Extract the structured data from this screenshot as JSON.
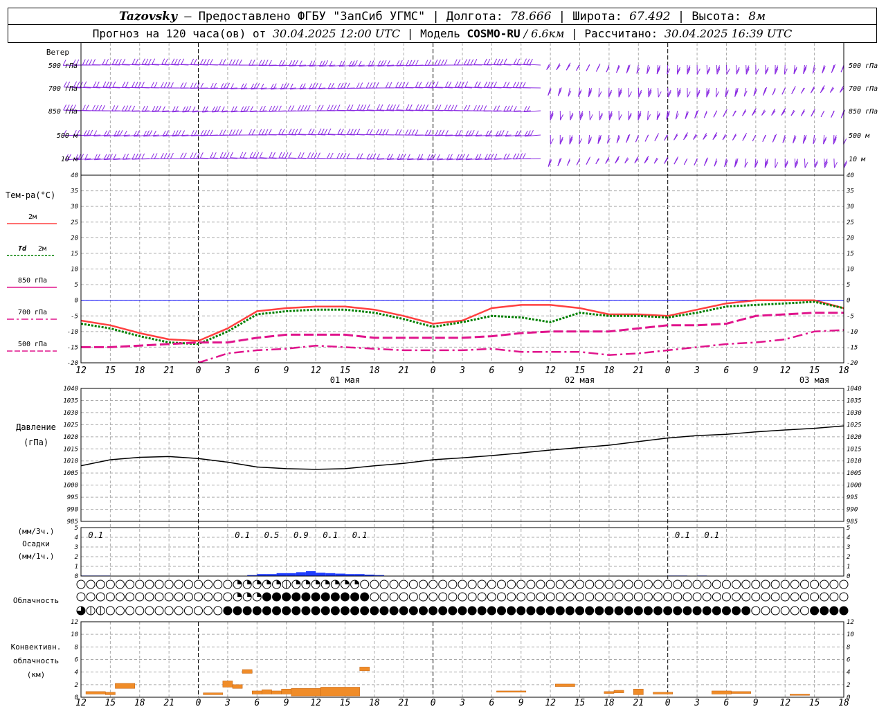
{
  "header": {
    "station": "Tazovsky",
    "dash": " — ",
    "provider": "Предоставлено ФГБУ \"ЗапСиб УГМС\"",
    "sep": " | ",
    "lon_label": "Долгота: ",
    "lon": "78.666",
    "lat_label": "Широта: ",
    "lat": "67.492",
    "alt_label": "Высота: ",
    "alt": "8м",
    "forecast_prefix": "Прогноз на 120 часа(ов) от ",
    "forecast_time": "30.04.2025 12:00 UTC",
    "model_label": "Модель ",
    "model": "COSMO-RU",
    "model_res": " / 6.6км",
    "calc_label": "Рассчитано: ",
    "calc_time": "30.04.2025 16:39 UTC"
  },
  "time_axis": {
    "hour_labels": [
      "12",
      "15",
      "18",
      "21",
      "0",
      "3",
      "6",
      "9",
      "12",
      "15",
      "18",
      "21",
      "0",
      "3",
      "6",
      "9",
      "12",
      "15",
      "18",
      "21",
      "0",
      "3",
      "6",
      "9",
      "12",
      "15",
      "18"
    ],
    "day_labels": [
      {
        "text": "01 мая",
        "hour_offset": 27
      },
      {
        "text": "02 мая",
        "hour_offset": 51
      },
      {
        "text": "03 мая",
        "hour_offset": 75
      }
    ],
    "midnight_offsets": [
      12,
      36,
      60
    ]
  },
  "wind": {
    "title": "Ветер",
    "levels": [
      "500 гПа",
      "700 гПа",
      "850 гПа",
      "500 м",
      "10 м"
    ],
    "barb_color": "#8a2be2"
  },
  "temp_legend": {
    "title": "Тем-ра(°C)",
    "t2m": "2м",
    "td_symbol": "Td",
    "td_level": "2м",
    "t850": "850 гПа",
    "t700": "700 гПа",
    "t500": "500 гПа"
  },
  "pressure_legend": {
    "title": "Давление",
    "unit": "(гПа)"
  },
  "precip_legend": {
    "unit3": "(мм/3ч.)",
    "title": "Осадки",
    "unit1": "(мм/1ч.)"
  },
  "cloud_legend": {
    "title": "Облачность"
  },
  "conv_legend": {
    "line1": "Конвективн.",
    "line2": "облачность",
    "line3": "(км)"
  },
  "colors": {
    "t2m": "#ff4040",
    "td": "#008000",
    "t850": "#e0148c",
    "zero_line": "#0000ff",
    "pressure": "#000000",
    "precip": "#1e3cff",
    "conv": "#f08c28",
    "grid": "#aaaaaa"
  },
  "chart_data": [
    {
      "type": "line",
      "name": "temperature",
      "ylim": [
        -20,
        40
      ],
      "yticks": [
        -20,
        -15,
        -10,
        -5,
        0,
        5,
        10,
        15,
        20,
        25,
        30,
        35,
        40
      ],
      "series": [
        {
          "name": "2м",
          "x": [
            0,
            3,
            6,
            9,
            12,
            15,
            18,
            21,
            24,
            27,
            30,
            33,
            36,
            39,
            42,
            45,
            48,
            51,
            54,
            57,
            60,
            63,
            66,
            69,
            72,
            75,
            78
          ],
          "values": [
            -6.5,
            -8,
            -10.5,
            -12.5,
            -13,
            -9,
            -3.5,
            -2.5,
            -2,
            -2,
            -3,
            -5,
            -7.5,
            -6.5,
            -2.5,
            -1.5,
            -1.5,
            -2.5,
            -4.5,
            -4.5,
            -5,
            -3,
            -1,
            0,
            0,
            0,
            -2.5
          ]
        },
        {
          "name": "Td 2м",
          "x": [
            0,
            3,
            6,
            9,
            12,
            15,
            18,
            21,
            24,
            27,
            30,
            33,
            36,
            39,
            42,
            45,
            48,
            51,
            54,
            57,
            60,
            63,
            66,
            69,
            72,
            75,
            78
          ],
          "values": [
            -7.5,
            -9,
            -11.5,
            -13.5,
            -14,
            -10,
            -4.5,
            -3.5,
            -3,
            -3,
            -4,
            -6,
            -8.5,
            -7,
            -5,
            -5.5,
            -7,
            -4,
            -5,
            -5,
            -5.5,
            -4,
            -2,
            -1.5,
            -1,
            -0.5,
            -2.5
          ]
        },
        {
          "name": "850 гПа",
          "x": [
            0,
            3,
            6,
            9,
            12,
            15,
            18,
            21,
            24,
            27,
            30,
            33,
            36,
            39,
            42,
            45,
            48,
            51,
            54,
            57,
            60,
            63,
            66,
            69,
            72,
            75,
            78
          ],
          "values": [
            -15,
            -15,
            -14.5,
            -14,
            -13.5,
            -13.5,
            -12,
            -11,
            -11,
            -11,
            -12,
            -12,
            -12,
            -12,
            -11.5,
            -10.5,
            -10,
            -10,
            -10,
            -9,
            -8,
            -8,
            -7.5,
            -5,
            -4.5,
            -4,
            -4
          ]
        },
        {
          "name": "700 гПа",
          "x": [
            12,
            15,
            18,
            21,
            24,
            27,
            30,
            33,
            36,
            39,
            42,
            45,
            48,
            51,
            54,
            57,
            60,
            63,
            66,
            69,
            72,
            75,
            78
          ],
          "values": [
            -20,
            -17,
            -16,
            -15.5,
            -14.5,
            -15,
            -15.5,
            -16,
            -16,
            -16,
            -15.5,
            -16.5,
            -16.5,
            -16.5,
            -17.5,
            -17,
            -16,
            -15,
            -14,
            -13.5,
            -12.5,
            -10,
            -9.5
          ]
        }
      ]
    },
    {
      "type": "line",
      "name": "pressure",
      "ylim": [
        985,
        1040
      ],
      "yticks": [
        985,
        990,
        995,
        1000,
        1005,
        1010,
        1015,
        1020,
        1025,
        1030,
        1035,
        1040
      ],
      "series": [
        {
          "name": "Давление",
          "x": [
            0,
            3,
            6,
            9,
            12,
            15,
            18,
            21,
            24,
            27,
            30,
            33,
            36,
            39,
            42,
            45,
            48,
            51,
            54,
            57,
            60,
            63,
            66,
            69,
            72,
            75,
            78
          ],
          "values": [
            1008,
            1010.5,
            1011.5,
            1011.8,
            1011,
            1009.5,
            1007.5,
            1006.8,
            1006.5,
            1006.8,
            1008,
            1009,
            1010.5,
            1011.3,
            1012.2,
            1013.3,
            1014.5,
            1015.5,
            1016.5,
            1018,
            1019.5,
            1020.5,
            1021,
            1022,
            1022.8,
            1023.5,
            1024.5
          ]
        }
      ]
    },
    {
      "type": "bar",
      "name": "precipitation",
      "ylim": [
        0,
        5
      ],
      "yticks": [
        0,
        1,
        2,
        3,
        4,
        5
      ],
      "hours": [
        0,
        1,
        2,
        17,
        18,
        19,
        20,
        21,
        22,
        23,
        24,
        25,
        26,
        27,
        28,
        29,
        30,
        60,
        61,
        63
      ],
      "values": [
        0.05,
        0.05,
        0.05,
        0.1,
        0.2,
        0.2,
        0.3,
        0.3,
        0.4,
        0.5,
        0.35,
        0.3,
        0.25,
        0.2,
        0.2,
        0.15,
        0.1,
        0.05,
        0.05,
        0.05
      ],
      "labels_3h": [
        {
          "hour": 1.5,
          "text": "0.1"
        },
        {
          "hour": 16.5,
          "text": "0.1"
        },
        {
          "hour": 19.5,
          "text": "0.5"
        },
        {
          "hour": 22.5,
          "text": "0.9"
        },
        {
          "hour": 25.5,
          "text": "0.1"
        },
        {
          "hour": 28.5,
          "text": "0.1"
        },
        {
          "hour": 61.5,
          "text": "0.1"
        },
        {
          "hour": 64.5,
          "text": "0.1"
        }
      ]
    },
    {
      "type": "bar",
      "name": "convective_cloud",
      "ylim": [
        0,
        12
      ],
      "yticks": [
        0,
        2,
        4,
        6,
        8,
        10,
        12
      ],
      "segments": [
        {
          "start": 0.5,
          "end": 2.5,
          "bottom": 0.5,
          "top": 0.9
        },
        {
          "start": 2.5,
          "end": 3.5,
          "bottom": 0.4,
          "top": 0.8
        },
        {
          "start": 3.5,
          "end": 5.5,
          "bottom": 1.4,
          "top": 2.2
        },
        {
          "start": 12.5,
          "end": 14.5,
          "bottom": 0.4,
          "top": 0.7
        },
        {
          "start": 14.5,
          "end": 15.5,
          "bottom": 1.6,
          "top": 2.6
        },
        {
          "start": 15.5,
          "end": 16.5,
          "bottom": 1.4,
          "top": 2.0
        },
        {
          "start": 16.5,
          "end": 17.5,
          "bottom": 3.8,
          "top": 4.4
        },
        {
          "start": 17.5,
          "end": 18.5,
          "bottom": 0.5,
          "top": 1.0
        },
        {
          "start": 18.5,
          "end": 19.5,
          "bottom": 0.5,
          "top": 1.2
        },
        {
          "start": 19.5,
          "end": 20.5,
          "bottom": 0.5,
          "top": 1.0
        },
        {
          "start": 20.5,
          "end": 21.5,
          "bottom": 0.5,
          "top": 1.3
        },
        {
          "start": 21.5,
          "end": 24.5,
          "bottom": 0.2,
          "top": 1.4
        },
        {
          "start": 24.5,
          "end": 28.5,
          "bottom": 0.2,
          "top": 1.6
        },
        {
          "start": 28.5,
          "end": 29.5,
          "bottom": 4.2,
          "top": 4.8
        },
        {
          "start": 42.5,
          "end": 45.5,
          "bottom": 0.8,
          "top": 1.0
        },
        {
          "start": 48.5,
          "end": 50.5,
          "bottom": 1.7,
          "top": 2.1
        },
        {
          "start": 53.5,
          "end": 54.5,
          "bottom": 0.6,
          "top": 0.9
        },
        {
          "start": 54.5,
          "end": 55.5,
          "bottom": 0.7,
          "top": 1.1
        },
        {
          "start": 56.5,
          "end": 57.5,
          "bottom": 0.4,
          "top": 1.3
        },
        {
          "start": 58.5,
          "end": 60.5,
          "bottom": 0.5,
          "top": 0.8
        },
        {
          "start": 64.5,
          "end": 66.5,
          "bottom": 0.5,
          "top": 1.0
        },
        {
          "start": 66.5,
          "end": 68.5,
          "bottom": 0.6,
          "top": 0.9
        },
        {
          "start": 72.5,
          "end": 74.5,
          "bottom": 0.3,
          "top": 0.5
        }
      ]
    }
  ],
  "cloud_rows": [
    "0000000000000000222221222222200000000000000000000000000000000000000000000000000",
    "0000000000000000222444444444440000000000000000000000000000000000000000000000000",
    "3110000000000004444444444444444444444444444444444444444444444444444440000004444"
  ]
}
